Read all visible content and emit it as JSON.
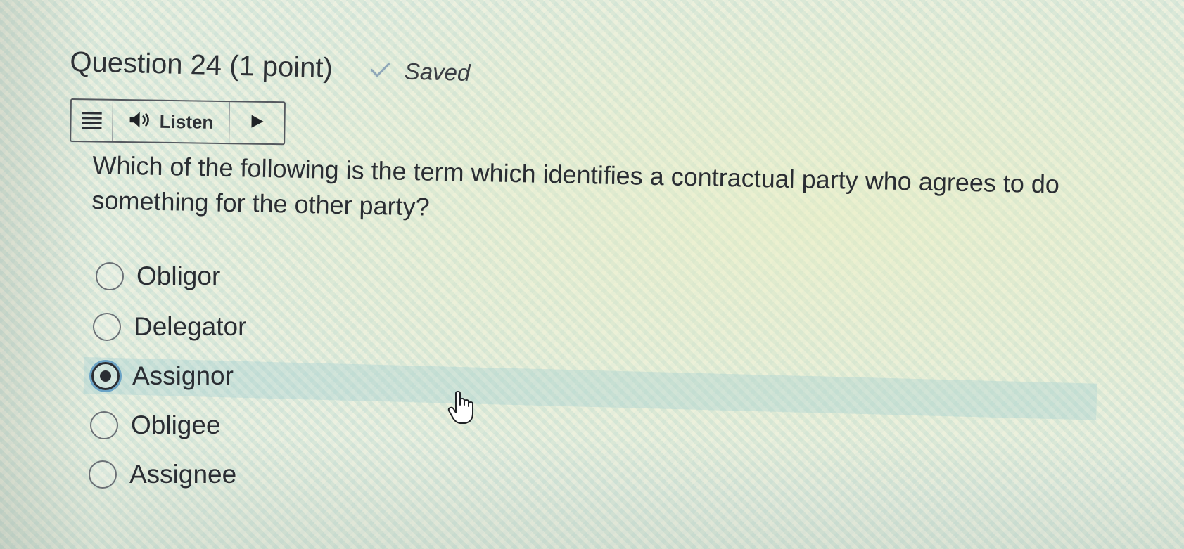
{
  "question": {
    "title": "Question 24 (1 point)",
    "saved_label": "Saved",
    "text": "Which of the following is the term which identifies a contractual party who agrees to do something for the other party?"
  },
  "toolbar": {
    "listen_label": "Listen",
    "icons": [
      "menu-icon",
      "speaker-icon",
      "play-icon"
    ]
  },
  "options": [
    {
      "label": "Obligor",
      "selected": false
    },
    {
      "label": "Delegator",
      "selected": false
    },
    {
      "label": "Assignor",
      "selected": true
    },
    {
      "label": "Obligee",
      "selected": false
    },
    {
      "label": "Assignee",
      "selected": false
    }
  ],
  "colors": {
    "text": "#2a2d33",
    "selected_ring": "#6aa3c6",
    "check": "#8fa6b8"
  }
}
